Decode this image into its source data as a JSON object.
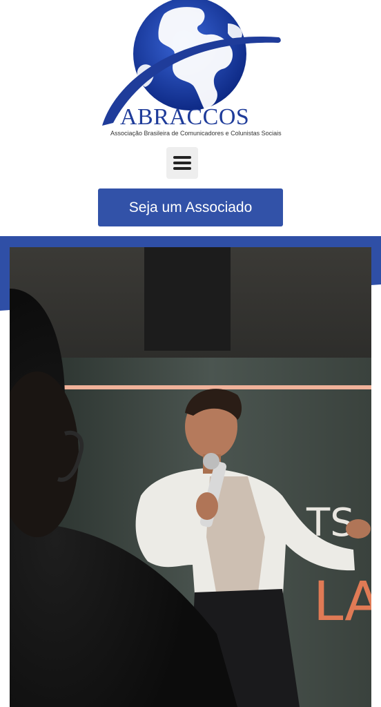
{
  "header": {
    "logo": {
      "wordmark": "ABRACCOS",
      "tagline": "Associação Brasileira de Comunicadores e Colunistas Sociais",
      "icon": "globe-icon"
    },
    "menu": {
      "icon": "hamburger-menu-icon"
    },
    "cta": {
      "label": "Seja um Associado"
    }
  },
  "hero": {
    "stage_text": {
      "line1": "TS",
      "line2": "LA"
    }
  },
  "colors": {
    "brand_blue": "#1f3c9a",
    "cta_blue": "#3252a8",
    "band_blue": "#2f4fa6"
  }
}
